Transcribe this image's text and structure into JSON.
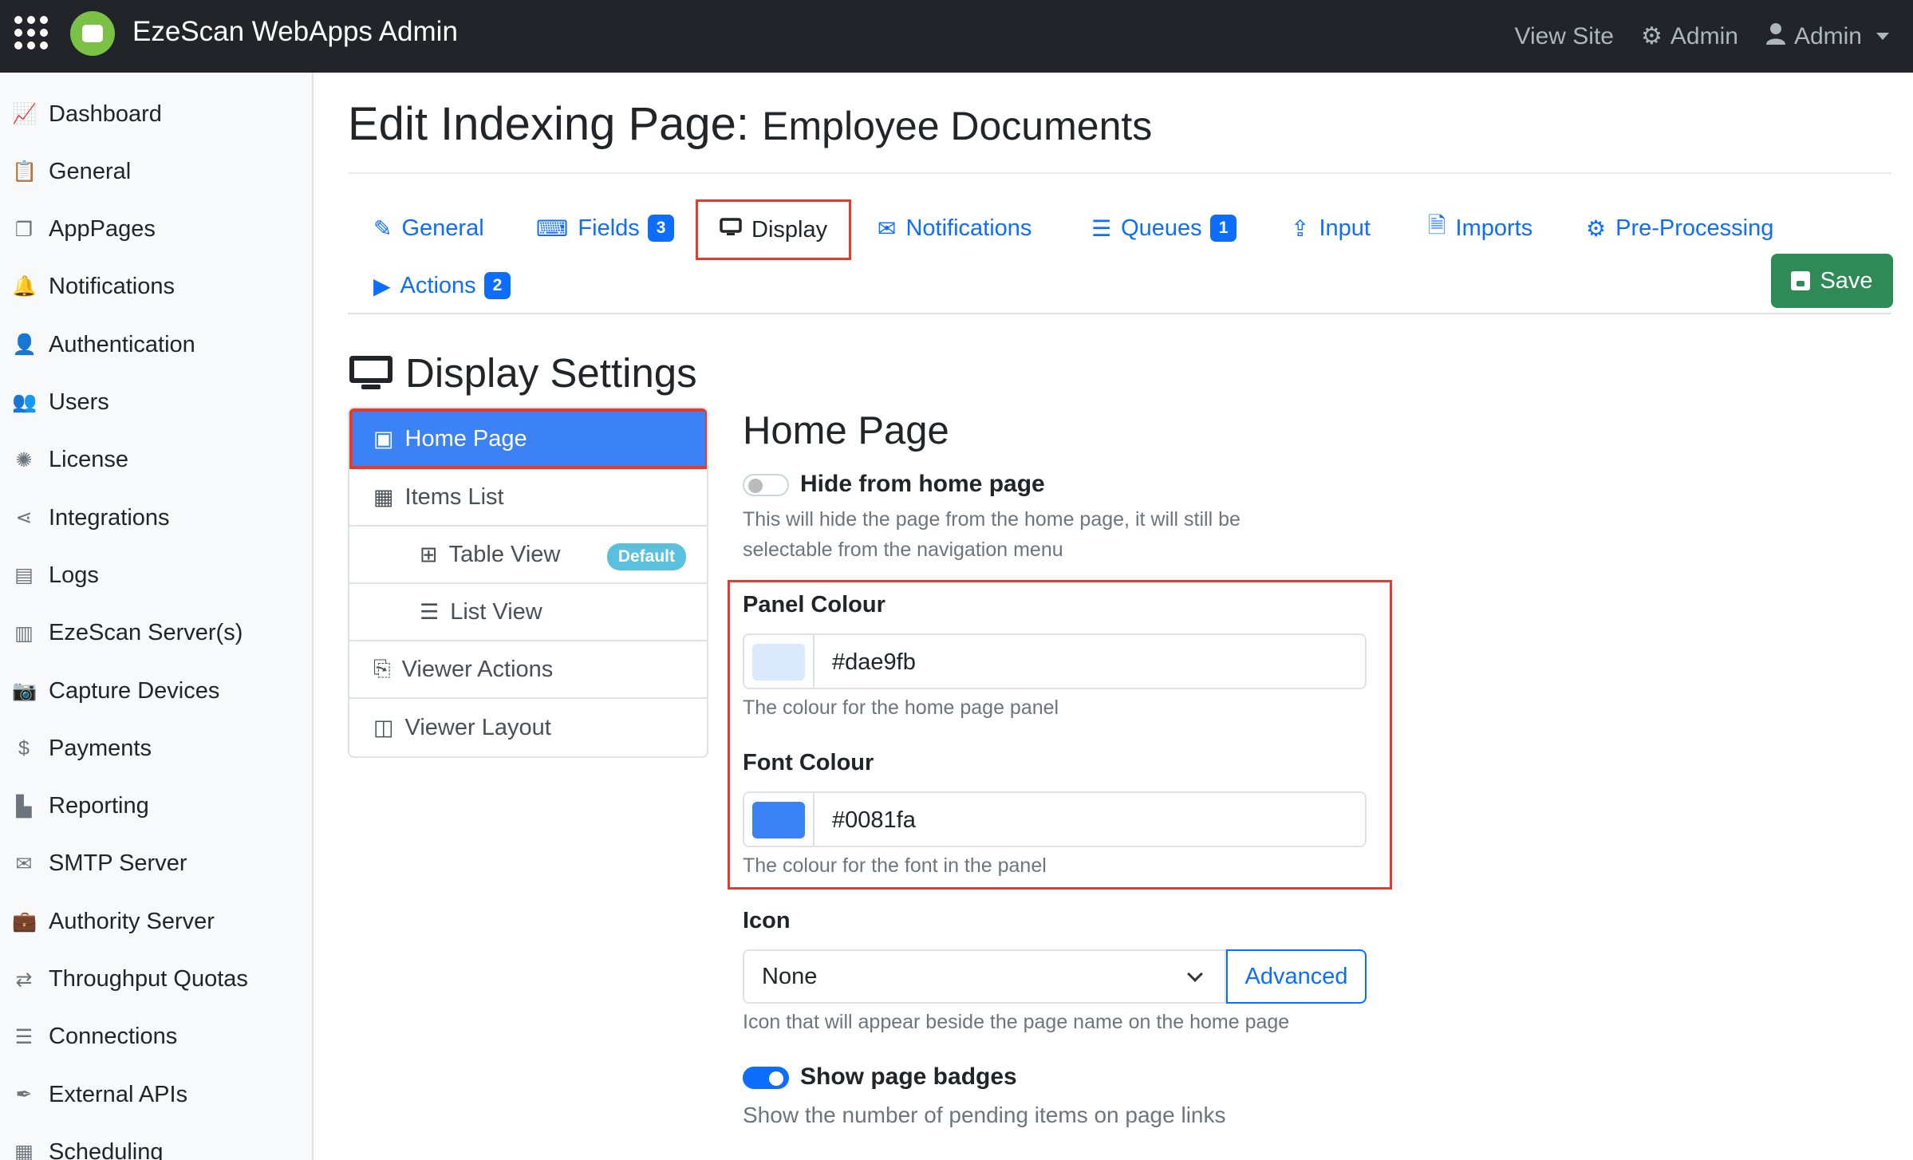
{
  "app": {
    "title": "EzeScan WebApps Admin"
  },
  "topnav": {
    "view_site": "View Site",
    "admin_settings": "Admin",
    "user_menu": "Admin"
  },
  "sidebar": {
    "items": [
      {
        "label": "Dashboard",
        "icon": "chart-line-icon"
      },
      {
        "label": "General",
        "icon": "clipboard-icon"
      },
      {
        "label": "AppPages",
        "icon": "pages-icon"
      },
      {
        "label": "Notifications",
        "icon": "bell-icon"
      },
      {
        "label": "Authentication",
        "icon": "user-lock-icon"
      },
      {
        "label": "Users",
        "icon": "users-icon"
      },
      {
        "label": "License",
        "icon": "certificate-icon"
      },
      {
        "label": "Integrations",
        "icon": "share-nodes-icon"
      },
      {
        "label": "Logs",
        "icon": "box-archive-icon"
      },
      {
        "label": "EzeScan Server(s)",
        "icon": "server-icon"
      },
      {
        "label": "Capture Devices",
        "icon": "camera-icon"
      },
      {
        "label": "Payments",
        "icon": "dollar-icon"
      },
      {
        "label": "Reporting",
        "icon": "chart-bar-icon"
      },
      {
        "label": "SMTP Server",
        "icon": "mail-server-icon"
      },
      {
        "label": "Authority Server",
        "icon": "briefcase-icon"
      },
      {
        "label": "Throughput Quotas",
        "icon": "arrows-exchange-icon"
      },
      {
        "label": "Connections",
        "icon": "database-icon"
      },
      {
        "label": "External APIs",
        "icon": "feather-icon"
      },
      {
        "label": "Scheduling",
        "icon": "calendar-icon"
      }
    ]
  },
  "page": {
    "title_prefix": "Edit Indexing Page:",
    "title_name": "Employee Documents"
  },
  "tabs": {
    "general": "General",
    "fields": "Fields",
    "fields_count": "3",
    "display": "Display",
    "notifications": "Notifications",
    "queues": "Queues",
    "queues_count": "1",
    "input": "Input",
    "imports": "Imports",
    "preprocessing": "Pre-Processing",
    "actions": "Actions",
    "actions_count": "2"
  },
  "save_label": "Save",
  "section": {
    "title": "Display Settings"
  },
  "settings_nav": {
    "home_page": "Home Page",
    "items_list": "Items List",
    "table_view": "Table View",
    "default_badge": "Default",
    "list_view": "List View",
    "viewer_actions": "Viewer Actions",
    "viewer_layout": "Viewer Layout"
  },
  "home_page": {
    "title": "Home Page",
    "hide_label": "Hide from home page",
    "hide_help_1": "This will hide the page from the home page, it will still be",
    "hide_help_2": "selectable from the navigation menu",
    "hide_enabled": false,
    "panel_colour_label": "Panel Colour",
    "panel_colour_value": "#dae9fb",
    "panel_colour_help": "The colour for the home page panel",
    "font_colour_label": "Font Colour",
    "font_colour_value": "#0081fa",
    "font_colour_help": "The colour for the font in the panel",
    "icon_label": "Icon",
    "icon_selected": "None",
    "advanced_label": "Advanced",
    "icon_help": "Icon that will appear beside the page name on the home page",
    "badges_label": "Show page badges",
    "badges_help": "Show the number of pending items on page links",
    "badges_enabled": true
  },
  "colors": {
    "primary": "#0d6efd",
    "success": "#2e8b57",
    "navbar": "#212529",
    "highlight": "#e23c2e",
    "panel_swatch": "#dae9fb",
    "font_swatch": "#3b82f6"
  }
}
